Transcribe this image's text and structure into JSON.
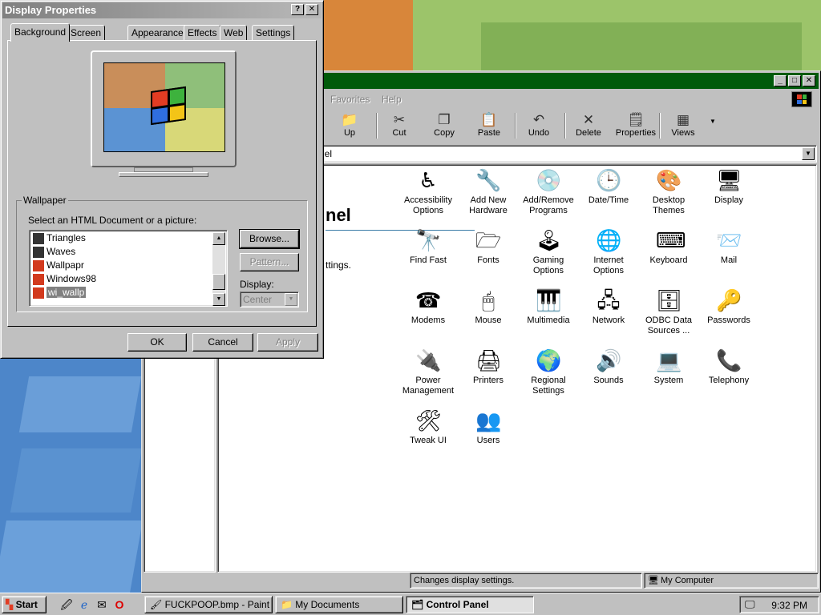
{
  "display_props": {
    "title": "Display Properties",
    "help_button": "?",
    "close_button": "✕",
    "tabs": [
      "Background",
      "Screen Saver",
      "Appearance",
      "Effects",
      "Web",
      "Settings"
    ],
    "selected_tab": "Background",
    "wallpaper_legend": "Wallpaper",
    "select_label": "Select an HTML Document or a picture:",
    "wallpaper_items": [
      "Triangles",
      "Waves",
      "Wallpapr",
      "Windows98",
      "wi_wallp"
    ],
    "selected_wallpaper": "wi_wallp",
    "browse_button": "Browse...",
    "pattern_button": "Pattern...",
    "display_label": "Display:",
    "display_value": "Center",
    "ok_button": "OK",
    "cancel_button": "Cancel",
    "apply_button": "Apply"
  },
  "control_panel": {
    "window_buttons": [
      "_",
      "□",
      "✕"
    ],
    "menu": [
      "Favorites",
      "Help"
    ],
    "toolbar": [
      "Up",
      "Cut",
      "Copy",
      "Paste",
      "Undo",
      "Delete",
      "Properties",
      "Views"
    ],
    "address_text": "nel",
    "heading": "nel",
    "description": "ttings.",
    "icons": [
      {
        "label": "Accessibility Options",
        "icon": "accessibility-icon"
      },
      {
        "label": "Add New Hardware",
        "icon": "add-hardware-icon"
      },
      {
        "label": "Add/Remove Programs",
        "icon": "add-remove-programs-icon"
      },
      {
        "label": "Date/Time",
        "icon": "date-time-icon"
      },
      {
        "label": "Desktop Themes",
        "icon": "desktop-themes-icon"
      },
      {
        "label": "Display",
        "icon": "display-icon"
      },
      {
        "label": "Find Fast",
        "icon": "find-fast-icon"
      },
      {
        "label": "Fonts",
        "icon": "fonts-icon"
      },
      {
        "label": "Gaming Options",
        "icon": "gaming-icon"
      },
      {
        "label": "Internet Options",
        "icon": "internet-icon"
      },
      {
        "label": "Keyboard",
        "icon": "keyboard-icon"
      },
      {
        "label": "Mail",
        "icon": "mail-icon"
      },
      {
        "label": "Modems",
        "icon": "modem-icon"
      },
      {
        "label": "Mouse",
        "icon": "mouse-icon"
      },
      {
        "label": "Multimedia",
        "icon": "multimedia-icon"
      },
      {
        "label": "Network",
        "icon": "network-icon"
      },
      {
        "label": "ODBC Data Sources ...",
        "icon": "odbc-icon"
      },
      {
        "label": "Passwords",
        "icon": "passwords-icon"
      },
      {
        "label": "Power Management",
        "icon": "power-icon"
      },
      {
        "label": "Printers",
        "icon": "printers-icon"
      },
      {
        "label": "Regional Settings",
        "icon": "regional-icon"
      },
      {
        "label": "Sounds",
        "icon": "sounds-icon"
      },
      {
        "label": "System",
        "icon": "system-icon"
      },
      {
        "label": "Telephony",
        "icon": "telephony-icon"
      },
      {
        "label": "Tweak UI",
        "icon": "tweak-ui-icon"
      },
      {
        "label": "Users",
        "icon": "users-icon"
      }
    ],
    "status_left": "Changes display settings.",
    "status_right": "My Computer"
  },
  "taskbar": {
    "start": "Start",
    "tasks": [
      "FUCKPOOP.bmp - Paint",
      "My Documents",
      "Control Panel"
    ],
    "active_task": "Control Panel",
    "clock": "9:32 PM"
  },
  "colors": {
    "cp_title": "#005a0a",
    "dialog_title_inactive": "#808080",
    "face": "#c0c0c0"
  }
}
